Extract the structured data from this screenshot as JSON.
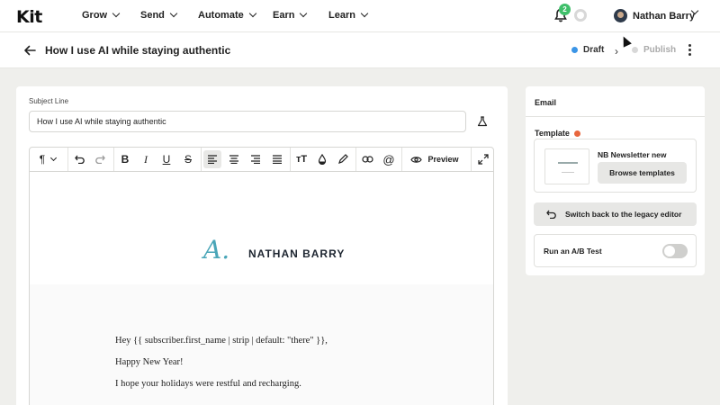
{
  "nav": {
    "logo": "Kit",
    "items": [
      {
        "label": "Grow"
      },
      {
        "label": "Send"
      },
      {
        "label": "Automate"
      },
      {
        "label": "Earn"
      },
      {
        "label": "Learn"
      }
    ],
    "notification_count": "2",
    "user_name": "Nathan Barry"
  },
  "titlebar": {
    "title": "How I use AI while staying authentic",
    "status_draft": "Draft",
    "status_publish": "Publish",
    "colors": {
      "draft": "#3b95e6",
      "publish": "#d0d0d0"
    }
  },
  "editor": {
    "subject_label": "Subject Line",
    "subject_value": "How I use AI while staying authentic",
    "toolbar": {
      "paragraph_icon": "paragraph-icon",
      "preview_label": "Preview"
    },
    "signature_mark": "A.",
    "signature_name": "NATHAN BARRY",
    "paragraphs": [
      "Hey {{ subscriber.first_name | strip | default: \"there\" }},",
      "Happy New Year!",
      "I hope your holidays were restful and recharging."
    ]
  },
  "sidebar": {
    "header": "Email",
    "template_label": "Template",
    "template_dot_color": "#e8663d",
    "template_name": "NB Newsletter new",
    "browse_label": "Browse templates",
    "legacy_label": "Switch back to the legacy editor",
    "ab_label": "Run an A/B Test",
    "ab_enabled": false
  }
}
